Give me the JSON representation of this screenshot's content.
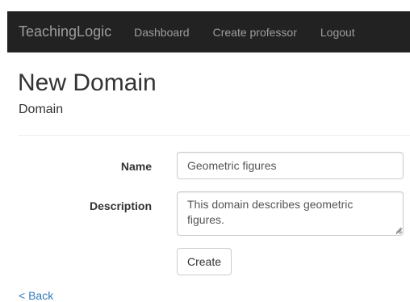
{
  "navbar": {
    "brand": "TeachingLogic",
    "links": [
      "Dashboard",
      "Create professor",
      "Logout"
    ]
  },
  "page": {
    "title": "New Domain",
    "subtitle": "Domain"
  },
  "form": {
    "name_label": "Name",
    "name_value": "Geometric figures",
    "description_label": "Description",
    "description_value": "This domain describes geometric figures.",
    "submit_label": "Create"
  },
  "footer": {
    "back_label": "< Back"
  },
  "colors": {
    "navbar_bg": "#222222",
    "navbar_text": "#9d9d9d",
    "link": "#337ab7"
  }
}
